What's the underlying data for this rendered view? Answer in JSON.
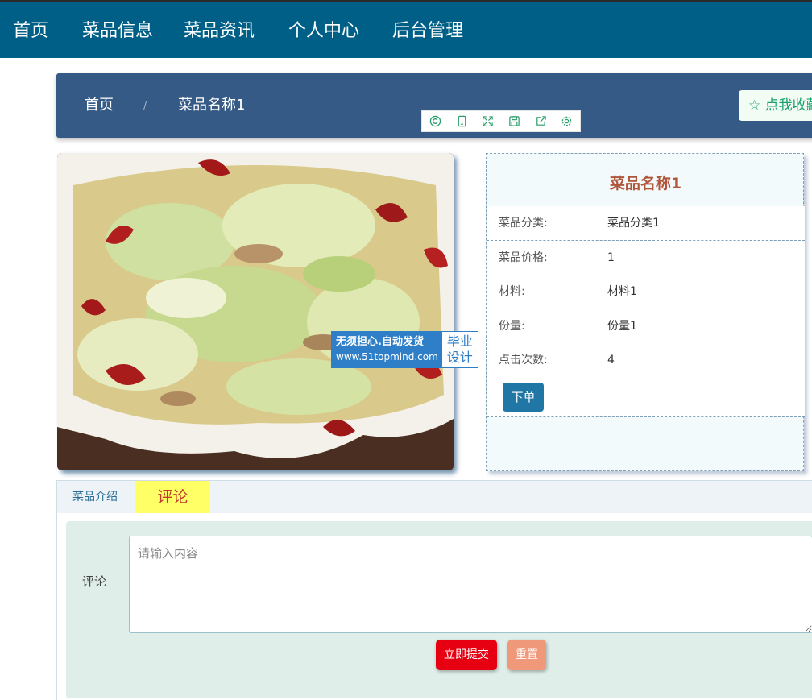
{
  "nav": {
    "items": [
      {
        "label": "首页"
      },
      {
        "label": "菜品信息"
      },
      {
        "label": "菜品资讯"
      },
      {
        "label": "个人中心"
      },
      {
        "label": "后台管理"
      }
    ],
    "active_index": 1
  },
  "breadcrumb": {
    "home": "首页",
    "separator": "/",
    "current": "菜品名称1",
    "favorite_label": "☆ 点我收藏"
  },
  "toolbar": {
    "icons": [
      "copyright-icon",
      "mobile-icon",
      "fullscreen-icon",
      "save-icon",
      "share-icon",
      "settings-icon"
    ]
  },
  "watermark": {
    "line1": "无须担心.自动发货",
    "line2": "www.51topmind.com",
    "right1": "毕业",
    "right2": "设计"
  },
  "detail": {
    "title": "菜品名称1",
    "rows": [
      {
        "label": "菜品分类:",
        "value": "菜品分类1"
      },
      {
        "label": "菜品价格:",
        "value": "1"
      },
      {
        "label": "材料:",
        "value": "材料1"
      },
      {
        "label": "份量:",
        "value": "份量1"
      },
      {
        "label": "点击次数:",
        "value": "4"
      }
    ],
    "order_label": "下单"
  },
  "tabs": {
    "intro_label": "菜品介绍",
    "comment_label": "评论"
  },
  "comment": {
    "field_label": "评论",
    "placeholder": "请输入内容",
    "submit_label": "立即提交",
    "reset_label": "重置"
  },
  "colors": {
    "nav_bg": "#005f86",
    "breadcrumb_bg": "#355a86",
    "accent_red": "#e60012",
    "order_button": "#2077a6",
    "title_brown": "#b0563a"
  }
}
